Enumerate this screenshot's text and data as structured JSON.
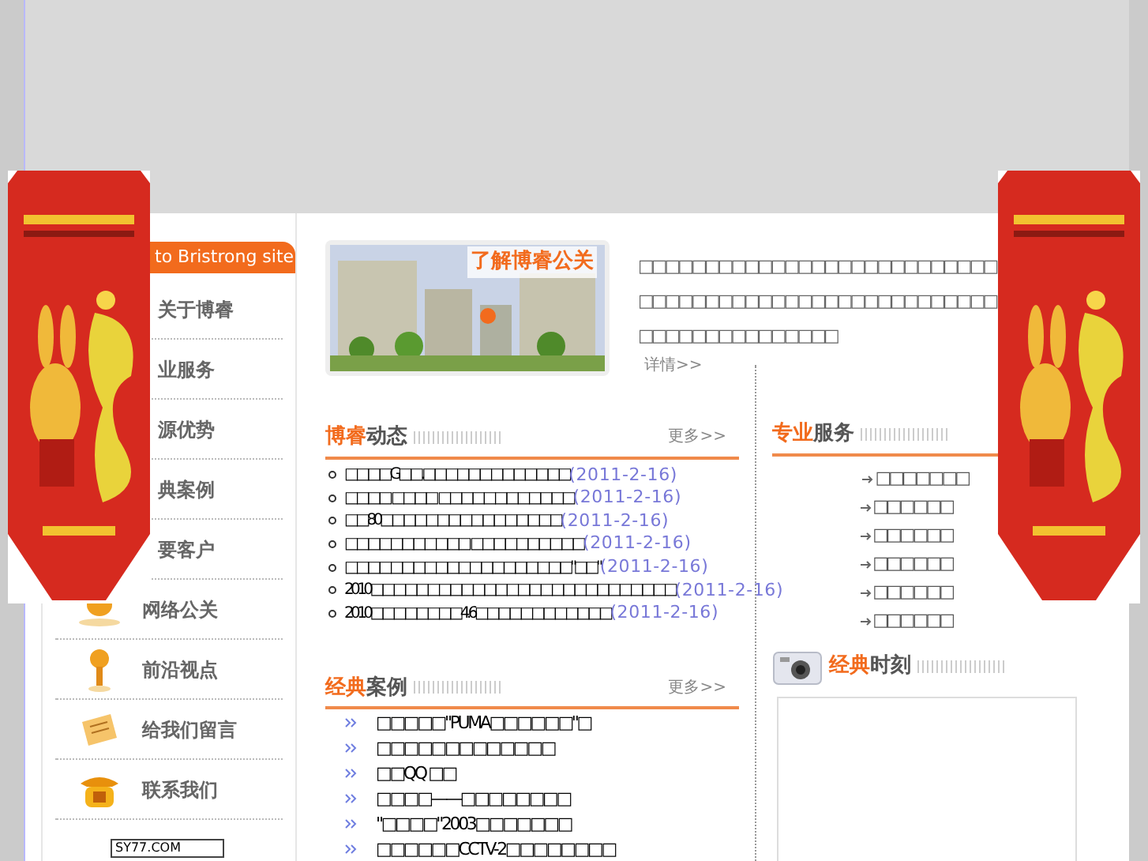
{
  "sidebar": {
    "header": "to Bristrong site",
    "items": [
      {
        "label": "关于博睿",
        "kind": "covered"
      },
      {
        "label": "业服务",
        "kind": "covered"
      },
      {
        "label": "源优势",
        "kind": "covered"
      },
      {
        "label": "典案例",
        "kind": "covered"
      },
      {
        "label": "要客户",
        "kind": "covered"
      },
      {
        "label": "网络公关",
        "kind": "coin"
      },
      {
        "label": "前沿视点",
        "kind": "lamp"
      },
      {
        "label": "给我们留言",
        "kind": "note"
      },
      {
        "label": "联系我们",
        "kind": "phone"
      }
    ],
    "badge": "SY77.COM"
  },
  "intro": {
    "banner_caption": "了解博睿公关",
    "lines": [
      "□□□□□□□□□□□□□□□□□□□□□□□□□□□",
      "□□□□□□□□□□□□□□□□□□□□□□□□□□□",
      "□□□□□□□□□□□□□□□"
    ],
    "details_link": "详情>>"
  },
  "news": {
    "title_accent": "博睿",
    "title_rest": "动态",
    "more": "更多>>",
    "items": [
      {
        "text": "□□□□G□□.□□□□□□□□□□□□□",
        "date": "(2011-2-16)"
      },
      {
        "text": "□□□□ □□□□ □□□□□□□□□□□□",
        "date": "(2011-2-16)"
      },
      {
        "text": "□□80□□□□□□□□□□□□□□□□",
        "date": "(2011-2-16)"
      },
      {
        "text": "□□□□□□□□□□□ □□□□□□□□□□",
        "date": "(2011-2-16)"
      },
      {
        "text": "□□□□□□□□□□□□□□□□□□□□\"□□\"",
        "date": "(2011-2-16)"
      },
      {
        "text": "2010□□□□□□□□□□□□□□□□□□□□□□□□□□□",
        "date": "(2011-2-16)"
      },
      {
        "text": "2010□□□□□□□□4.6□□□□□□□□□□□□",
        "date": "(2011-2-16)"
      }
    ]
  },
  "cases": {
    "title_accent": "经典",
    "title_rest": "案例",
    "more": "更多>>",
    "items": [
      "□□□□□\"PUMA□□□□□□\"□",
      "□□□□□□□□□□□□□",
      "□□QQ □□",
      "□□□□——□□□□□□□□",
      "\"□□□□\"2003□□□□□□□",
      "□□□□□□CCTV-2□□□□□□□□"
    ]
  },
  "services": {
    "title_accent": "专业",
    "title_rest": "服务",
    "items": [
      "□□□□□□□",
      "□□□□□□",
      "□□□□□□",
      "□□□□□□",
      "□□□□□□",
      "□□□□□□"
    ]
  },
  "moments": {
    "title_accent": "经典",
    "title_rest": "时刻"
  }
}
